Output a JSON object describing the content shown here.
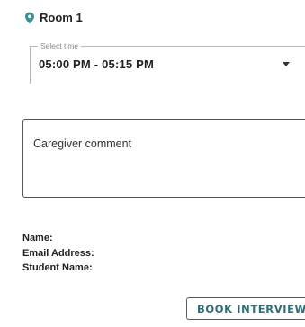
{
  "room": {
    "label": "Room 1",
    "icon": "location-pin-icon"
  },
  "time_select": {
    "legend": "Select time",
    "value": "05:00 PM - 05:15 PM"
  },
  "comment": {
    "placeholder": "Caregiver comment"
  },
  "info": {
    "name_label": "Name:",
    "email_label": "Email Address:",
    "student_label": "Student Name:"
  },
  "book_button": {
    "label": "BOOK INTERVIEW"
  },
  "colors": {
    "accent": "#2f6f73",
    "pin": "#3a8f8f"
  }
}
